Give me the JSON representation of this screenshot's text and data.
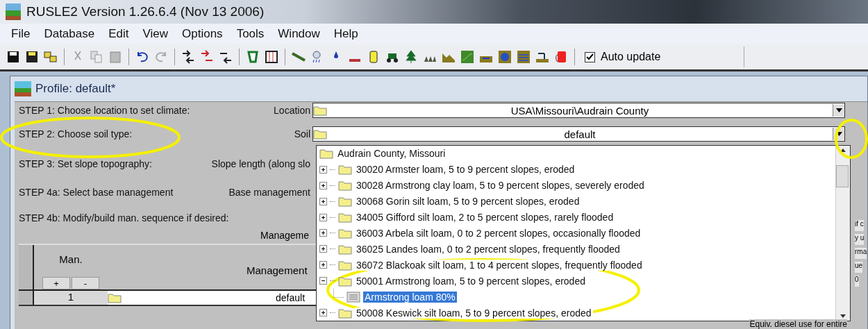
{
  "window": {
    "title": "RUSLE2 Version 1.26.6.4 (Nov 13 2006)"
  },
  "menu": [
    "File",
    "Database",
    "Edit",
    "View",
    "Options",
    "Tools",
    "Window",
    "Help"
  ],
  "toolbar": {
    "auto_update": {
      "label": "Auto update",
      "checked": true
    }
  },
  "profile": {
    "title": "Profile:  default*",
    "steps": [
      {
        "kind": "combo",
        "step": "STEP 1: Choose location to set climate:",
        "field_label": "Location",
        "value": "USA\\Missouri\\Audrain County"
      },
      {
        "kind": "combo",
        "step": "STEP 2: Choose soil type:",
        "field_label": "Soil",
        "value": "default"
      },
      {
        "kind": "label",
        "step": "STEP 3: Set slope topography:",
        "field_label": "Slope length (along slo"
      },
      {
        "kind": "label",
        "step": "STEP 4a: Select base management",
        "field_label": "Base management"
      },
      {
        "kind": "plain",
        "step": "STEP 4b: Modify/build man. sequence if desired:"
      }
    ],
    "management": {
      "group_label": "Manageme",
      "columns": [
        "Man.",
        "Management"
      ],
      "buttons": [
        "+",
        "-"
      ],
      "rows": [
        {
          "number": "1",
          "name": "default"
        }
      ]
    },
    "right_fragments": [
      "if c",
      "y u",
      "rma",
      "ue",
      "0"
    ],
    "footer_text": "Equiv. diesel use for entire"
  },
  "soil_dropdown": {
    "header": "Audrain County, Missouri",
    "items": [
      {
        "label": "30020 Armster loam, 5 to 9 percent slopes, eroded",
        "expanded": false,
        "selected": false
      },
      {
        "label": "30028 Armstrong clay loam, 5 to 9 percent slopes, severely eroded",
        "expanded": false,
        "selected": false
      },
      {
        "label": "30068 Gorin silt loam, 5 to 9 percent slopes, eroded",
        "expanded": false,
        "selected": false
      },
      {
        "label": "34005 Gifford silt loam, 2 to 5 percent slopes, rarely flooded",
        "expanded": false,
        "selected": false
      },
      {
        "label": "36003 Arbela silt loam, 0 to 2 percent slopes, occasionally flooded",
        "expanded": false,
        "selected": false
      },
      {
        "label": "36025 Landes loam, 0 to 2 percent slopes, frequently flooded",
        "expanded": false,
        "selected": false
      },
      {
        "label": "36072 Blackoak silt loam, 1 to 4 percent slopes, frequently flooded",
        "expanded": false,
        "selected": false
      },
      {
        "label": "50001 Armstrong loam, 5 to 9 percent slopes, eroded",
        "expanded": true,
        "selected": false,
        "children": [
          {
            "label": "Armstrong loam  80%",
            "selected": true
          }
        ]
      },
      {
        "label": "50008 Keswick silt loam, 5 to 9 percent slopes, eroded",
        "expanded": false,
        "selected": false
      }
    ]
  }
}
